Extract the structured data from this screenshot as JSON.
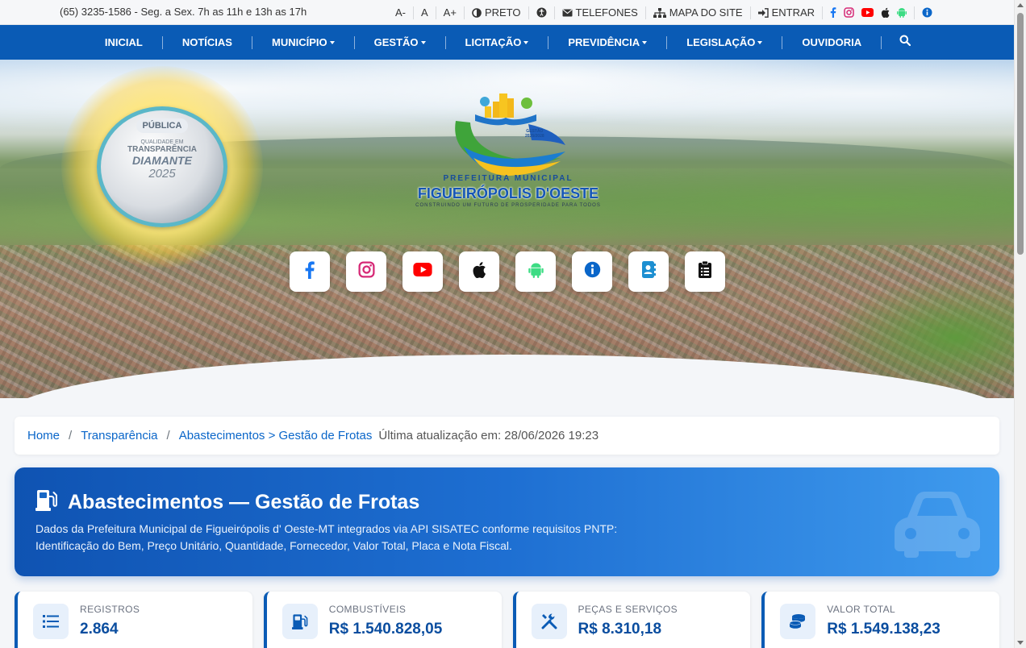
{
  "topbar": {
    "hours": "(65) 3235-1586 - Seg. a Sex. 7h as 11h e 13h as 17h",
    "font_decrease": "A-",
    "font_normal": "A",
    "font_increase": "A+",
    "contrast": "PRETO",
    "phones": "TELEFONES",
    "sitemap": "MAPA DO SITE",
    "login": "ENTRAR"
  },
  "nav": {
    "items": [
      "INICIAL",
      "NOTÍCIAS",
      "MUNICÍPIO",
      "GESTÃO",
      "LICITAÇÃO",
      "PREVIDÊNCIA",
      "LEGISLAÇÃO",
      "OUVIDORIA"
    ]
  },
  "hero": {
    "seal": {
      "badge": "PÚBLICA",
      "line1": "QUALIDADE EM",
      "line2": "TRANSPARÊNCIA",
      "line3": "DIAMANTE",
      "year": "2025"
    },
    "logo": {
      "gestao": "GESTÃO",
      "gestao_years": "2025/2028",
      "line1": "PREFEITURA MUNICIPAL",
      "line2": "FIGUEIRÓPOLIS D'OESTE",
      "slogan": "CONSTRUINDO UM FUTURO DE PROSPERIDADE PARA TODOS"
    },
    "tiles": [
      "facebook-icon",
      "instagram-icon",
      "youtube-icon",
      "apple-icon",
      "android-icon",
      "info-icon",
      "contact-book-icon",
      "clipboard-icon"
    ]
  },
  "breadcrumb": {
    "home": "Home",
    "transparency": "Transparência",
    "current": "Abastecimentos > Gestão de Frotas",
    "updated": "Última atualização em: 28/06/2026 19:23"
  },
  "banner": {
    "title": "Abastecimentos — Gestão de Frotas",
    "desc_line1": "Dados da Prefeitura Municipal de Figueirópolis d' Oeste-MT integrados via API SISATEC conforme requisitos PNTP:",
    "desc_line2": "Identificação do Bem, Preço Unitário, Quantidade, Fornecedor, Valor Total, Placa e Nota Fiscal."
  },
  "stats": [
    {
      "label": "REGISTROS",
      "value": "2.864",
      "icon": "list-icon"
    },
    {
      "label": "COMBUSTÍVEIS",
      "value": "R$ 1.540.828,05",
      "icon": "gas-pump-icon"
    },
    {
      "label": "PEÇAS E SERVIÇOS",
      "value": "R$ 8.310,18",
      "icon": "tools-icon"
    },
    {
      "label": "VALOR TOTAL",
      "value": "R$ 1.549.138,23",
      "icon": "coins-icon"
    }
  ],
  "colors": {
    "nav_blue": "#0a5bb5",
    "link_blue": "#0a66c9",
    "banner_start": "#0f53b2",
    "banner_end": "#3f9bee"
  }
}
